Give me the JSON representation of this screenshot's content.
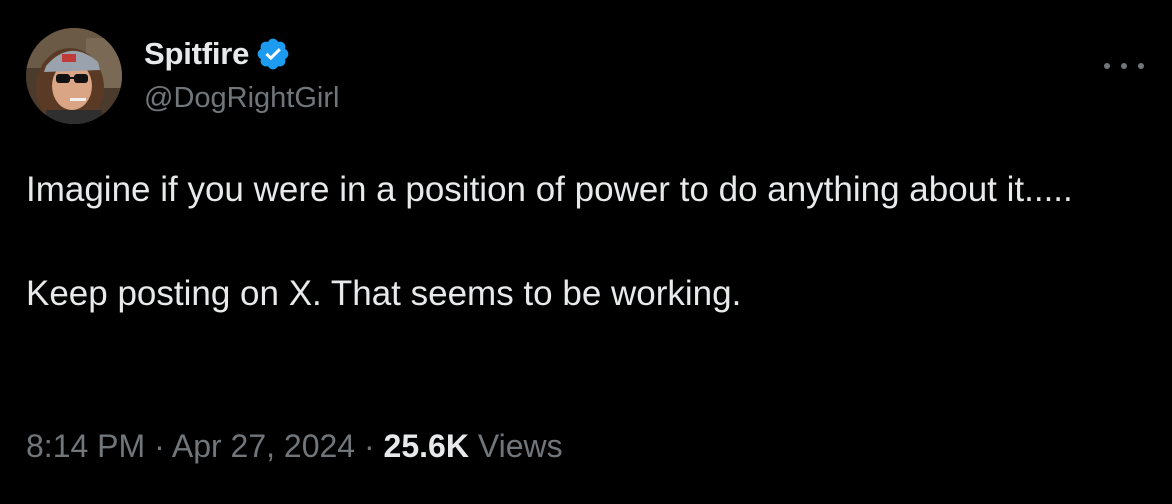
{
  "author": {
    "display_name": "Spitfire",
    "handle": "@DogRightGirl",
    "verified": true,
    "verified_icon": "verified-badge-icon",
    "verified_color": "#1d9bf0"
  },
  "more_icon": "more-horizontal-icon",
  "tweet": {
    "line1": "Imagine if you were in a position of power to do anything about it.....",
    "line2": "Keep posting on X. That seems to be working."
  },
  "meta": {
    "time": "8:14 PM",
    "separator": " · ",
    "date": "Apr 27, 2024",
    "views_count": "25.6K",
    "views_label": "Views"
  },
  "colors": {
    "background": "#000000",
    "text_primary": "#e7e9ea",
    "text_secondary": "#71767b"
  }
}
